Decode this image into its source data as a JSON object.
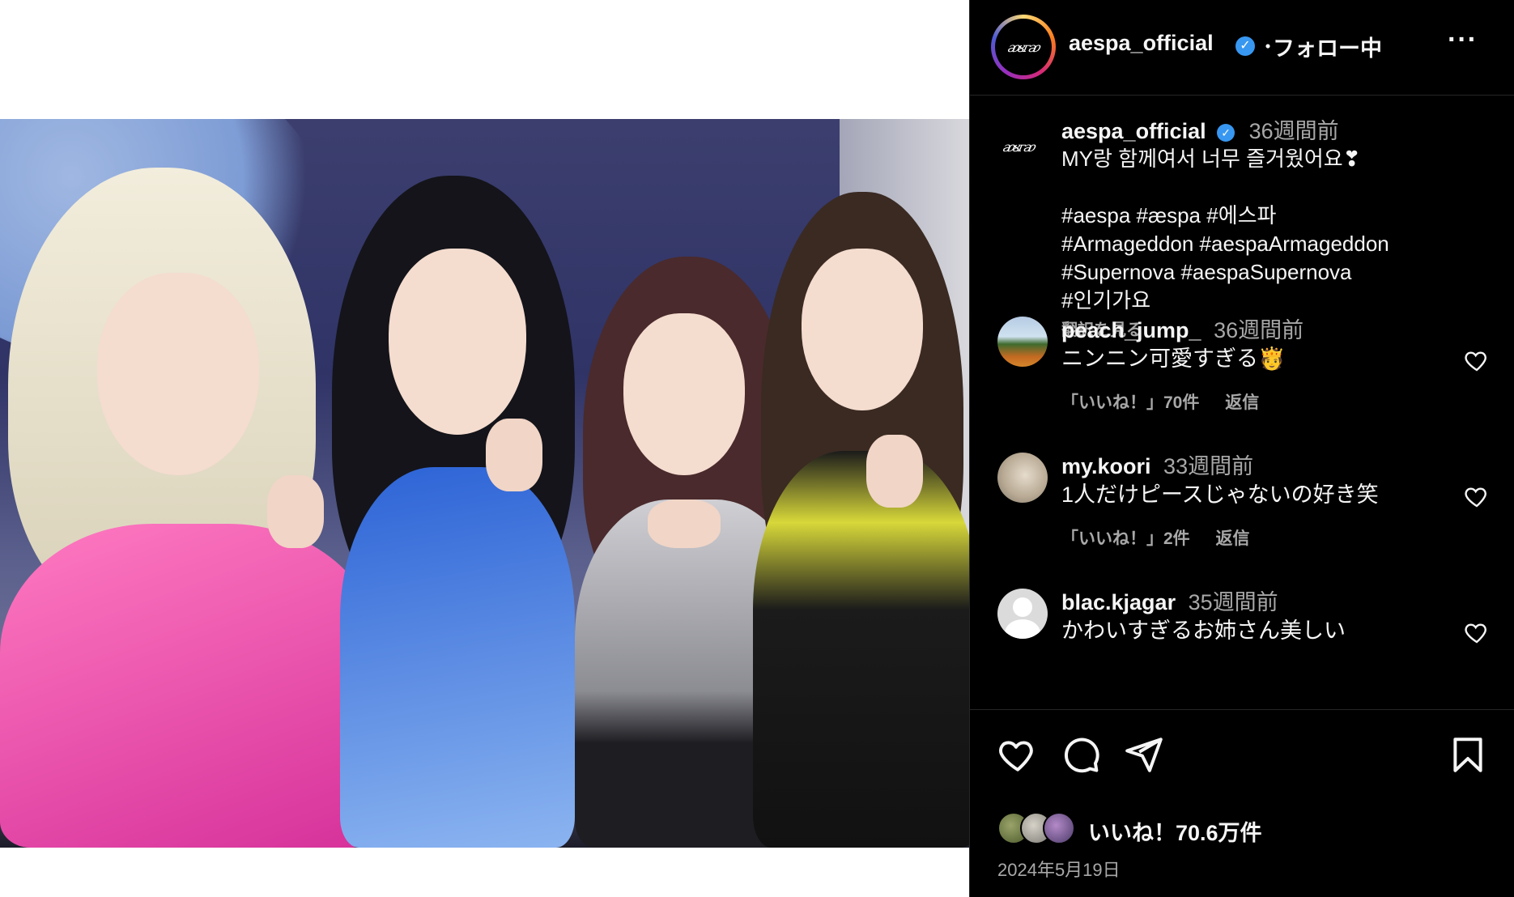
{
  "post": {
    "author": "aespa_official",
    "verified": true,
    "separator": "・",
    "follow_status": "フォロー中",
    "more_label": "···",
    "caption": {
      "time": "36週間前",
      "text": "MY랑 함께여서 너무 즐거웠어요❣\n\n#aespa #æspa #에스파\n#Armageddon #aespaArmageddon\n#Supernova #aespaSupernova\n#인기가요",
      "translate_label": "翻訳を見る"
    },
    "comments": [
      {
        "user": "peach_jump_",
        "time": "36週間前",
        "text": "ニンニン可愛すぎる🫅",
        "likes": "「いいね！」70件",
        "reply": "返信",
        "avatar": "landscape-photo"
      },
      {
        "user": "my.koori",
        "time": "33週間前",
        "text": "1人だけピースじゃないの好き笑",
        "likes": "「いいね！」2件",
        "reply": "返信",
        "avatar": "portrait-photo"
      },
      {
        "user": "blac.kjagar",
        "time": "35週間前",
        "text": "かわいすぎるお姉さん美しい",
        "avatar": "default-user"
      }
    ],
    "likes_label": "いいね！70.6万件",
    "date": "2024年5月19日"
  },
  "icons": {
    "like": "heart-icon",
    "comment": "comment-bubble-icon",
    "share": "paper-plane-icon",
    "save": "bookmark-icon",
    "more": "more-dots-icon",
    "verified": "verified-badge-icon"
  },
  "colors": {
    "panel_bg": "#000000",
    "text_primary": "#f5f5f5",
    "text_secondary": "#a8a8a8",
    "verified_blue": "#3897f0",
    "divider": "#262626"
  }
}
